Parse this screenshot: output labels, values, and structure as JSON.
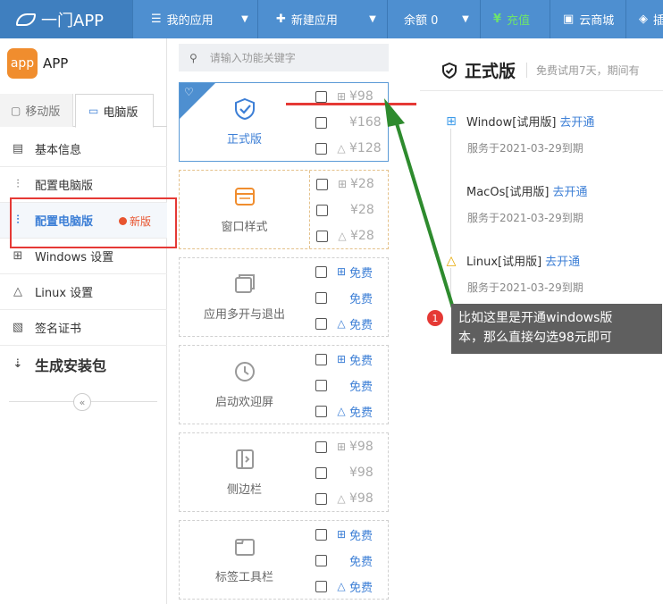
{
  "topbar": {
    "brand": "一门APP",
    "menus": [
      {
        "label": "我的应用",
        "icon": "list-icon"
      },
      {
        "label": "新建应用",
        "icon": "plus-icon"
      },
      {
        "label": "余额 0",
        "icon": ""
      },
      {
        "label": "充值",
        "icon": "recharge-icon"
      },
      {
        "label": "云商城",
        "icon": "cloud-shop-icon"
      },
      {
        "label": "插",
        "icon": "plugin-icon"
      }
    ],
    "colors": {
      "bar": "#4e8fd0",
      "brand_bg": "#3f7fbf",
      "charge": "#6de26d"
    }
  },
  "sidebar": {
    "logo": {
      "badge": "app",
      "name": "APP"
    },
    "tabs": [
      {
        "label": "移动版"
      },
      {
        "label": "电脑版"
      }
    ],
    "items": [
      {
        "label": "基本信息"
      },
      {
        "label": "配置电脑版"
      },
      {
        "label": "配置电脑版",
        "badge": "新版"
      },
      {
        "label": "Windows 设置"
      },
      {
        "label": "Linux 设置"
      },
      {
        "label": "签名证书"
      },
      {
        "label": "生成安装包"
      }
    ],
    "collapse": "«"
  },
  "search": {
    "placeholder": "请输入功能关键字"
  },
  "features": [
    {
      "name": "正式版",
      "icon": "shield-check-icon",
      "options": [
        {
          "os": "windows",
          "price": "¥98"
        },
        {
          "os": "mac",
          "price": "¥168"
        },
        {
          "os": "linux",
          "price": "¥128"
        }
      ]
    },
    {
      "name": "窗口样式",
      "icon": "window-style-icon",
      "options": [
        {
          "os": "windows",
          "price": "¥28"
        },
        {
          "os": "mac",
          "price": "¥28"
        },
        {
          "os": "linux",
          "price": "¥28"
        }
      ]
    },
    {
      "name": "应用多开与退出",
      "icon": "multi-window-icon",
      "options": [
        {
          "os": "windows",
          "price": "免费"
        },
        {
          "os": "mac",
          "price": "免费"
        },
        {
          "os": "linux",
          "price": "免费"
        }
      ]
    },
    {
      "name": "启动欢迎屏",
      "icon": "clock-icon",
      "options": [
        {
          "os": "windows",
          "price": "免费"
        },
        {
          "os": "mac",
          "price": "免费"
        },
        {
          "os": "linux",
          "price": "免费"
        }
      ]
    },
    {
      "name": "侧边栏",
      "icon": "sidebar-icon",
      "options": [
        {
          "os": "windows",
          "price": "¥98"
        },
        {
          "os": "mac",
          "price": "¥98"
        },
        {
          "os": "linux",
          "price": "¥98"
        }
      ]
    },
    {
      "name": "标签工具栏",
      "icon": "tab-toolbar-icon",
      "options": [
        {
          "os": "windows",
          "price": "免费"
        },
        {
          "os": "mac",
          "price": "免费"
        },
        {
          "os": "linux",
          "price": "免费"
        }
      ]
    }
  ],
  "detail": {
    "title": "正式版",
    "subtitle": "免费试用7天，期间有",
    "platforms": [
      {
        "name": "Window[试用版]",
        "action": "去开通",
        "date": "服务于2021-03-29到期"
      },
      {
        "name": "MacOs[试用版]",
        "action": "去开通",
        "date": "服务于2021-03-29到期"
      },
      {
        "name": "Linux[试用版]",
        "action": "去开通",
        "date": "服务于2021-03-29到期"
      }
    ]
  },
  "annotation": {
    "badge": "1",
    "text_line1": "比如这里是开通windows版",
    "text_line2": "本，那么直接勾选98元即可"
  }
}
